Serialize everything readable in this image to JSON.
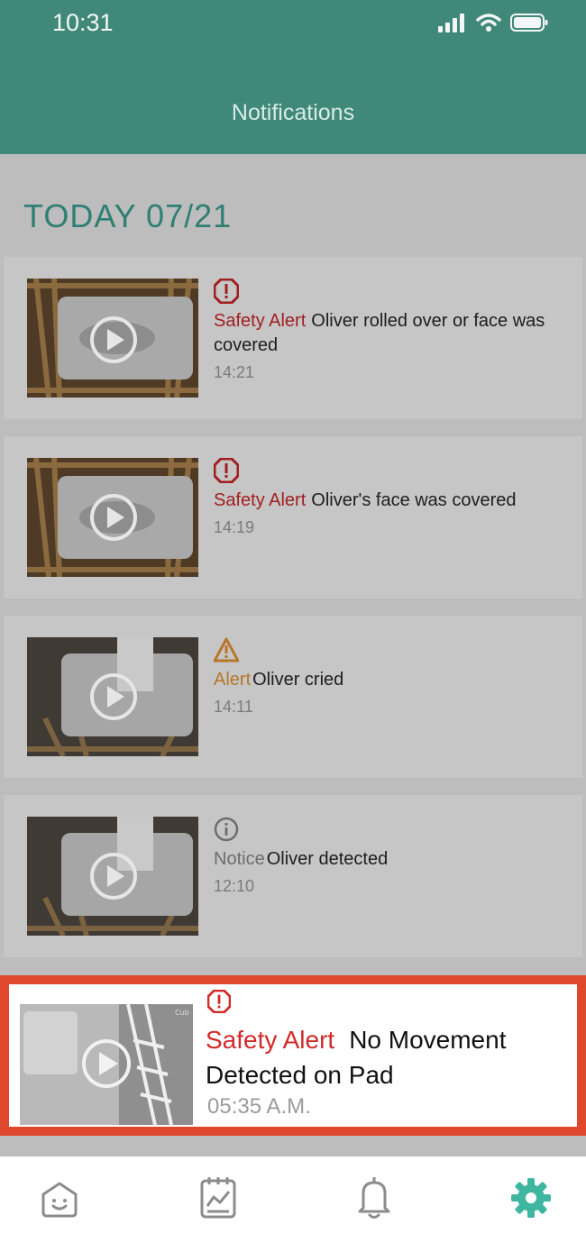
{
  "status_bar": {
    "time": "10:31"
  },
  "header": {
    "title": "Notifications"
  },
  "section": {
    "date": "TODAY 07/21"
  },
  "notifications": [
    {
      "type_label": "Safety Alert",
      "message": "Oliver rolled over or face was covered",
      "time": "14:21",
      "icon": "exclamation-octagon-icon",
      "color": "#a11f21"
    },
    {
      "type_label": "Safety Alert",
      "message": "Oliver's face was covered",
      "time": "14:19",
      "icon": "exclamation-octagon-icon",
      "color": "#a11f21"
    },
    {
      "type_label": "Alert",
      "message": "Oliver cried",
      "time": "14:11",
      "icon": "warning-triangle-icon",
      "color": "#b7772b"
    },
    {
      "type_label": "Notice",
      "message": "Oliver detected",
      "time": "12:10",
      "icon": "info-circle-icon",
      "color": "#6d6d6d"
    }
  ],
  "highlighted": {
    "type_label": "Safety Alert",
    "message": "No Movement Detected on Pad",
    "time": "05:35 A.M.",
    "icon": "exclamation-octagon-icon",
    "color": "#d12a2a",
    "watermark": "Cub"
  },
  "tabs": [
    {
      "name": "home",
      "icon": "baby-home-icon"
    },
    {
      "name": "reports",
      "icon": "report-chart-icon"
    },
    {
      "name": "notifications",
      "icon": "bell-icon"
    },
    {
      "name": "settings",
      "icon": "gear-icon",
      "active": true
    }
  ],
  "colors": {
    "header": "#40897a",
    "accent": "#3eb6a0",
    "highlight_border": "#e0482d"
  }
}
